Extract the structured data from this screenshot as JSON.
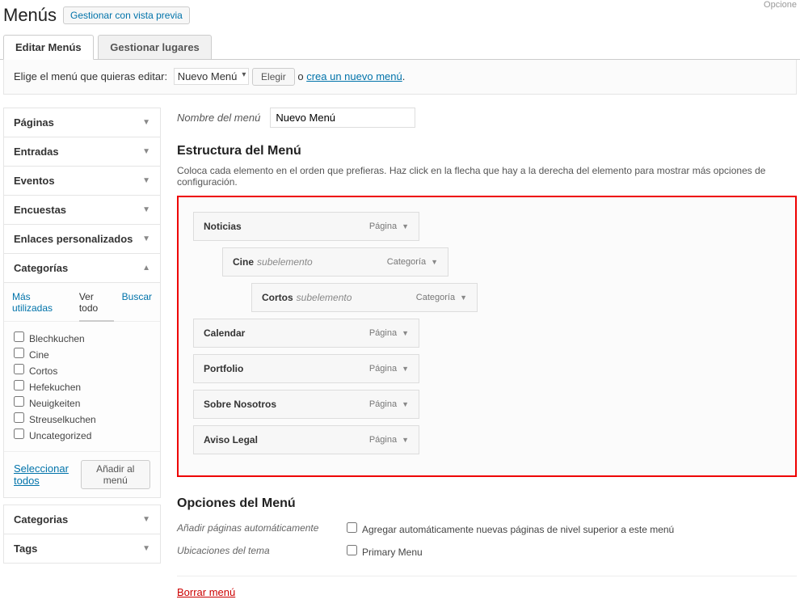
{
  "header": {
    "title": "Menús",
    "preview_btn": "Gestionar con vista previa",
    "top_option": "Opcione"
  },
  "tabs": {
    "edit": "Editar Menús",
    "manage": "Gestionar lugares"
  },
  "select_bar": {
    "label": "Elige el menú que quieras editar:",
    "selected": "Nuevo Menú",
    "choose": "Elegir",
    "or": "o",
    "create_link": "crea un nuevo menú"
  },
  "sidebar": {
    "panels": [
      {
        "title": "Páginas",
        "open": false
      },
      {
        "title": "Entradas",
        "open": false
      },
      {
        "title": "Eventos",
        "open": false
      },
      {
        "title": "Encuestas",
        "open": false
      },
      {
        "title": "Enlaces personalizados",
        "open": false
      }
    ],
    "categories_title": "Categorías",
    "sub_tabs": {
      "most_used": "Más utilizadas",
      "view_all": "Ver todo",
      "search": "Buscar"
    },
    "category_items": [
      "Blechkuchen",
      "Cine",
      "Cortos",
      "Hefekuchen",
      "Neuigkeiten",
      "Streuselkuchen",
      "Uncategorized"
    ],
    "select_all": "Seleccionar todos",
    "add_to_menu": "Añadir al menú",
    "extra_panels": [
      {
        "title": "Categorias"
      },
      {
        "title": "Tags"
      }
    ]
  },
  "main": {
    "name_label": "Nombre del menú",
    "name_value": "Nuevo Menú",
    "structure_title": "Estructura del Menú",
    "structure_desc": "Coloca cada elemento en el orden que prefieras. Haz click en la flecha que hay a la derecha del elemento para mostrar más opciones de configuración.",
    "items": [
      {
        "label": "Noticias",
        "type": "Página",
        "indent": 0
      },
      {
        "label": "Cine",
        "sub": "subelemento",
        "type": "Categoría",
        "indent": 1
      },
      {
        "label": "Cortos",
        "sub": "subelemento",
        "type": "Categoría",
        "indent": 2
      },
      {
        "label": "Calendar",
        "type": "Página",
        "indent": 0
      },
      {
        "label": "Portfolio",
        "type": "Página",
        "indent": 0
      },
      {
        "label": "Sobre Nosotros",
        "type": "Página",
        "indent": 0
      },
      {
        "label": "Aviso Legal",
        "type": "Página",
        "indent": 0
      }
    ],
    "options_title": "Opciones del Menú",
    "auto_add_label": "Añadir páginas automáticamente",
    "auto_add_check": "Agregar automáticamente nuevas páginas de nivel superior a este menú",
    "theme_loc_label": "Ubicaciones del tema",
    "theme_loc_check": "Primary Menu",
    "delete": "Borrar menú"
  }
}
